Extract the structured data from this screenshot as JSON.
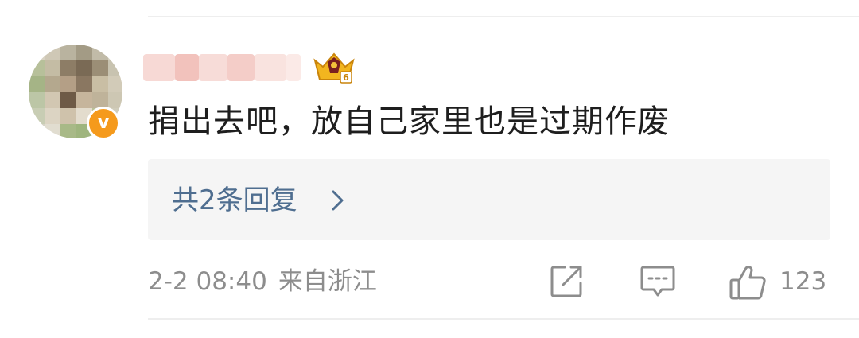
{
  "comment": {
    "username": "",
    "text": "捐出去吧，放自己家里也是过期作废",
    "replies_label": "共2条回复",
    "date": "2-2 08:40",
    "location": "来自浙江",
    "like_count": "123"
  },
  "badges": {
    "verified_symbol": "v",
    "level_icon": "crown-level-icon"
  },
  "colors": {
    "link": "#4f6e90",
    "meta": "#8d8d8d",
    "text": "#1e1e1e",
    "badge": "#f59a1c"
  }
}
